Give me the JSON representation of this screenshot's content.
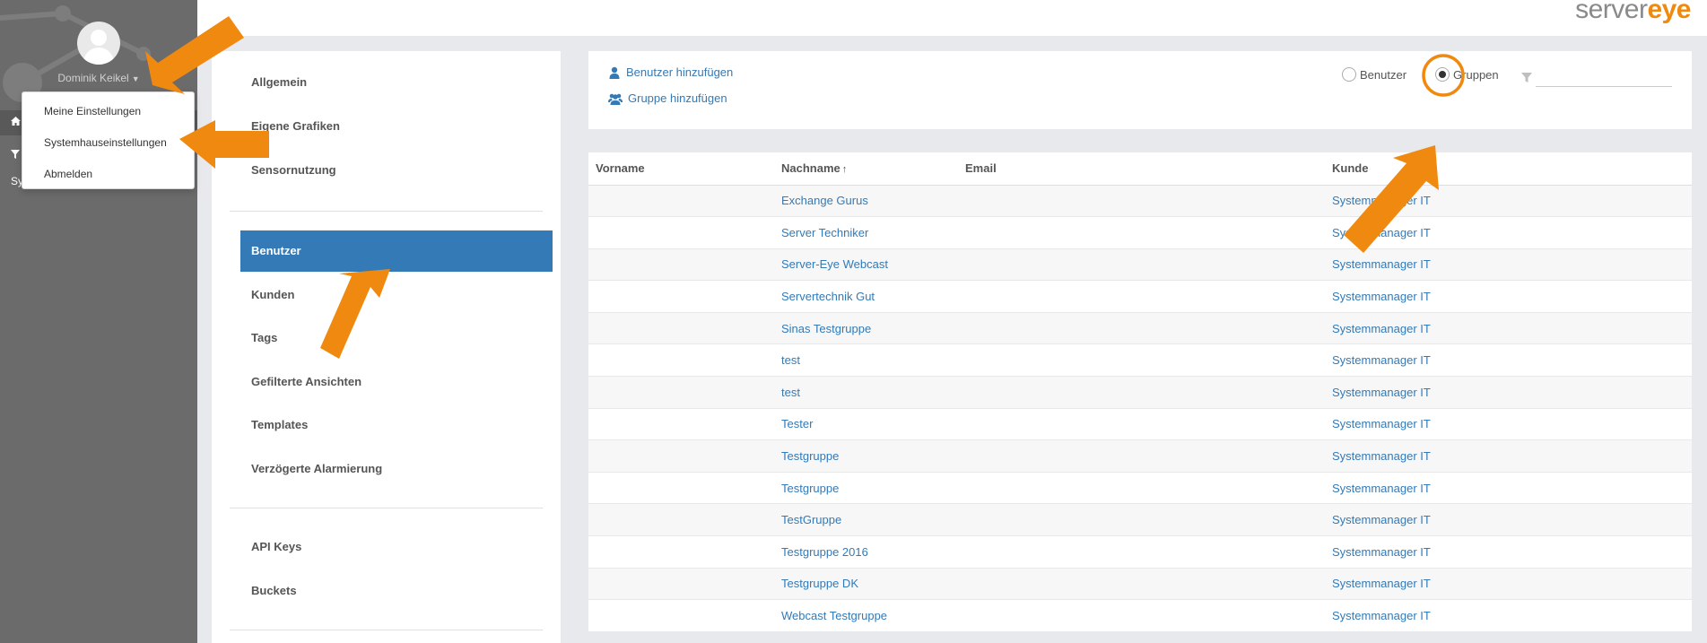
{
  "user": {
    "name": "Dominik Keikel"
  },
  "sidebar": {
    "row3_text": "Sy"
  },
  "dropdown": {
    "items": [
      "Meine Einstellungen",
      "Systemhauseinstellungen",
      "Abmelden"
    ]
  },
  "logo": {
    "part1": "server",
    "part2": "eye"
  },
  "settings_menu": {
    "group1": [
      "Allgemein",
      "Eigene Grafiken",
      "Sensornutzung"
    ],
    "group2": [
      "Benutzer",
      "Kunden",
      "Tags",
      "Gefilterte Ansichten",
      "Templates",
      "Verzögerte Alarmierung"
    ],
    "group3": [
      "API Keys",
      "Buckets"
    ],
    "active": "Benutzer"
  },
  "toolbar": {
    "add_user": "Benutzer hinzufügen",
    "add_group": "Gruppe hinzufügen",
    "radio_users": "Benutzer",
    "radio_groups": "Gruppen",
    "selected": "Gruppen",
    "filter_value": ""
  },
  "table": {
    "headers": [
      "Vorname",
      "Nachname",
      "Email",
      "Kunde"
    ],
    "sort_indicator": "↑",
    "rows": [
      {
        "vorname": "",
        "nachname": "Exchange Gurus",
        "email": "",
        "kunde": "Systemmanager IT"
      },
      {
        "vorname": "",
        "nachname": "Server Techniker",
        "email": "",
        "kunde": "Systemmanager IT"
      },
      {
        "vorname": "",
        "nachname": "Server-Eye Webcast",
        "email": "",
        "kunde": "Systemmanager IT"
      },
      {
        "vorname": "",
        "nachname": "Servertechnik Gut",
        "email": "",
        "kunde": "Systemmanager IT"
      },
      {
        "vorname": "",
        "nachname": "Sinas Testgruppe",
        "email": "",
        "kunde": "Systemmanager IT"
      },
      {
        "vorname": "",
        "nachname": "test",
        "email": "",
        "kunde": "Systemmanager IT"
      },
      {
        "vorname": "",
        "nachname": "test",
        "email": "",
        "kunde": "Systemmanager IT"
      },
      {
        "vorname": "",
        "nachname": "Tester",
        "email": "",
        "kunde": "Systemmanager IT"
      },
      {
        "vorname": "",
        "nachname": "Testgruppe",
        "email": "",
        "kunde": "Systemmanager IT"
      },
      {
        "vorname": "",
        "nachname": "Testgruppe",
        "email": "",
        "kunde": "Systemmanager IT"
      },
      {
        "vorname": "",
        "nachname": "TestGruppe",
        "email": "",
        "kunde": "Systemmanager IT"
      },
      {
        "vorname": "",
        "nachname": "Testgruppe 2016",
        "email": "",
        "kunde": "Systemmanager IT"
      },
      {
        "vorname": "",
        "nachname": "Testgruppe DK",
        "email": "",
        "kunde": "Systemmanager IT"
      },
      {
        "vorname": "",
        "nachname": "Webcast Testgruppe",
        "email": "",
        "kunde": "Systemmanager IT"
      }
    ]
  },
  "colors": {
    "accent": "#337ab7",
    "annotation": "#f0890f",
    "sidebar": "#6b6b6b"
  },
  "icons": [
    "user-icon",
    "users-icon",
    "filter-icon",
    "home-icon",
    "caret-down-icon",
    "sort-asc-icon"
  ]
}
